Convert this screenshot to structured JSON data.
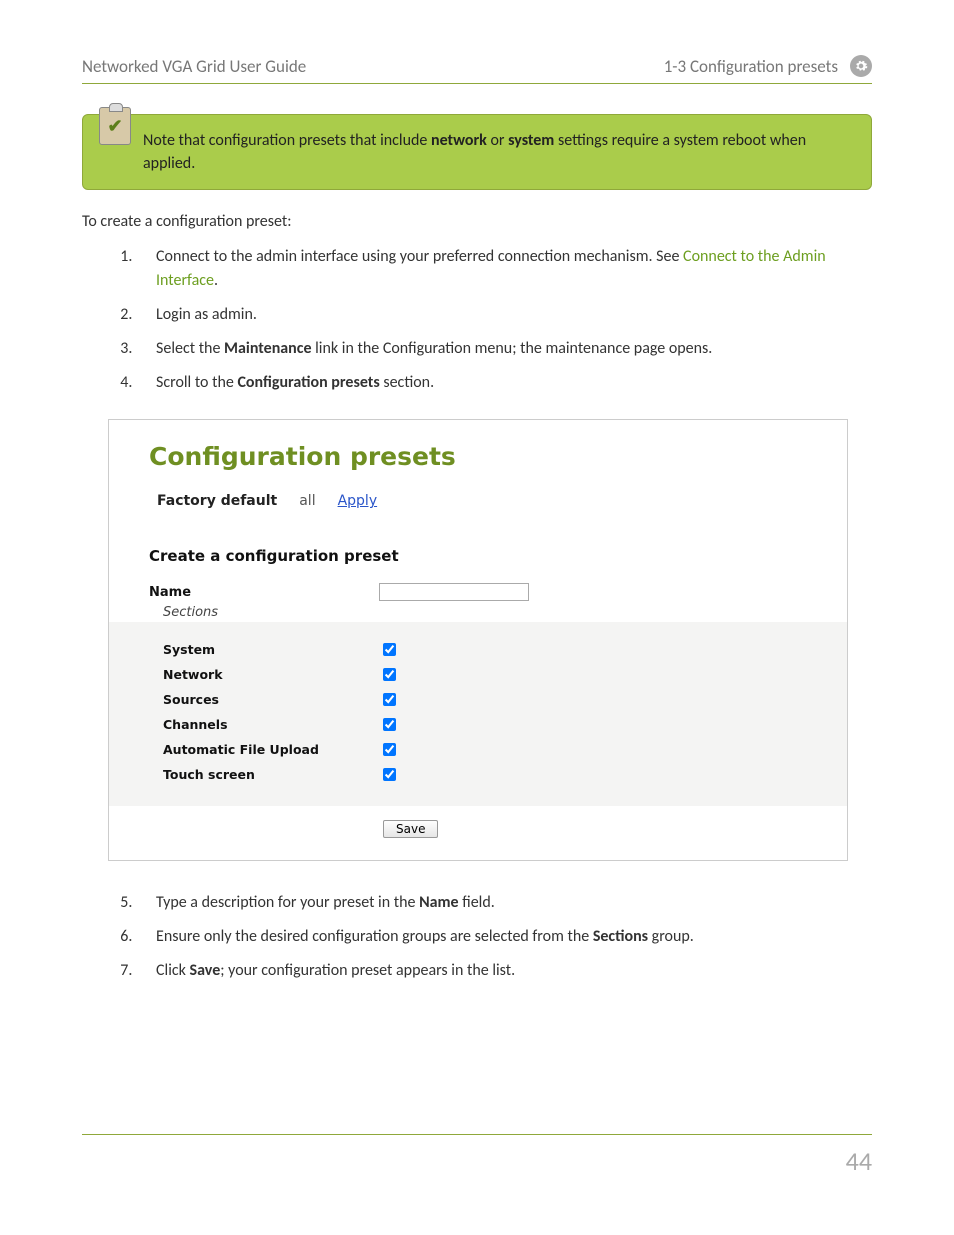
{
  "header": {
    "left": "Networked VGA Grid User Guide",
    "right": "1-3 Configuration presets"
  },
  "note": {
    "prefix": "Note that configuration presets that include ",
    "bold1": "network",
    "mid": " or ",
    "bold2": "system",
    "suffix": " settings require a system reboot when applied."
  },
  "intro": "To create a configuration preset:",
  "steps_a": {
    "s1_prefix": "Connect to the admin interface using your preferred connection mechanism. See ",
    "s1_link": "Connect to the Admin Interface",
    "s1_suffix": ".",
    "s2": "Login as admin.",
    "s3_prefix": "Select the ",
    "s3_bold": "Maintenance",
    "s3_suffix": " link in the Configuration menu; the maintenance page opens.",
    "s4_prefix": "Scroll to the ",
    "s4_bold": "Configuration presets",
    "s4_suffix": " section."
  },
  "panel": {
    "title": "Configuration presets",
    "factory_default": "Factory default",
    "all": "all",
    "apply": "Apply",
    "create_title": "Create a configuration preset",
    "name_label": "Name",
    "sections_label": "Sections",
    "sections": {
      "s0": "System",
      "s1": "Network",
      "s2": "Sources",
      "s3": "Channels",
      "s4": "Automatic File Upload",
      "s5": "Touch screen"
    },
    "save": "Save"
  },
  "steps_b": {
    "s5_prefix": "Type a description for your preset in the ",
    "s5_bold": "Name",
    "s5_suffix": " field.",
    "s6_prefix": "Ensure only the desired configuration groups are selected from the ",
    "s6_bold": "Sections",
    "s6_suffix": " group.",
    "s7_prefix": "Click ",
    "s7_bold": "Save",
    "s7_suffix": "; your configuration preset appears in the list."
  },
  "page_number": "44"
}
